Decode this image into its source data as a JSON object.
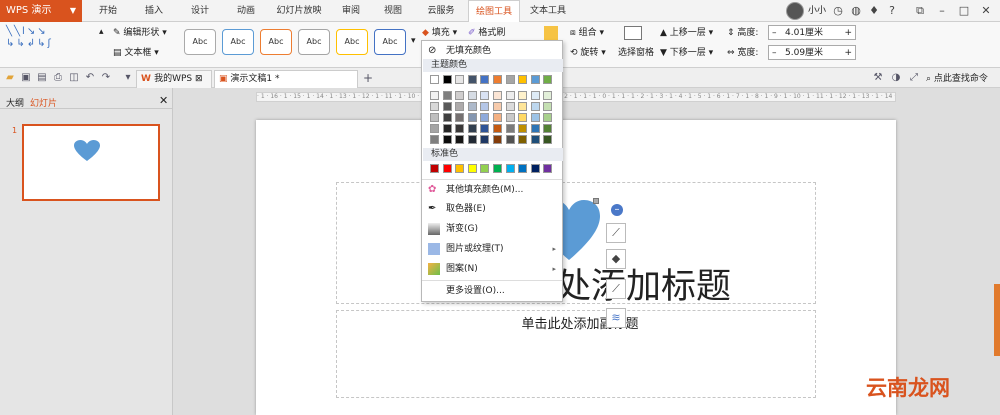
{
  "app": {
    "name": "WPS 演示"
  },
  "menu": {
    "tabs": [
      {
        "label": "开始"
      },
      {
        "label": "插入"
      },
      {
        "label": "设计"
      },
      {
        "label": "动画"
      },
      {
        "label": "幻灯片放映"
      },
      {
        "label": "审阅"
      },
      {
        "label": "视图"
      },
      {
        "label": "云服务"
      },
      {
        "label": "绘图工具"
      },
      {
        "label": "文本工具"
      }
    ]
  },
  "user": {
    "name": "小小"
  },
  "ribbon": {
    "edit_shape": "编辑形状",
    "text_box": "文本框",
    "style_samples": [
      "Abc",
      "Abc",
      "Abc",
      "Abc",
      "Abc",
      "Abc"
    ],
    "fill": "填充",
    "format_painter": "格式刷",
    "group": "组合",
    "rotate": "旋转",
    "selection_pane": "选择窗格",
    "bring_forward": "上移一层",
    "send_backward": "下移一层",
    "height_label": "高度:",
    "height_value": "4.01厘米",
    "width_label": "宽度:",
    "width_value": "5.09厘米"
  },
  "tabs": {
    "docs": [
      {
        "label": "我的WPS"
      },
      {
        "label": "演示文稿1 *"
      }
    ],
    "search": "点此查找命令"
  },
  "panel": {
    "outline": "大纲",
    "slides": "幻灯片",
    "slide_number": "1"
  },
  "ruler": {
    "text": "· 1 · 16 · 1 · 15 · 1 · 14 · 1 · 13 · 1 · 12 · 1 · 11 · 1 · 10 · 1 · 9 · 1 · 8 · 1 · 7 · 1 · 6 · 1 · 5 · 1 · 4 · 1 · 3 · 1 · 2 · 1 · 1 · 1 · 0 · 1 · 1 · 1 · 2 · 1 · 3 · 1 · 4 · 1 · 5 · 1 · 6 · 1 · 7 · 1 · 8 · 1 · 9 · 1 · 10 · 1 · 11 · 1 · 12 · 1 · 13 · 1 · 14 · 1 · 15 · 1 · 16 ·"
  },
  "slide": {
    "title_placeholder": "单击此处添加标题",
    "subtitle_placeholder": "单击此处添加副标题"
  },
  "fill_menu": {
    "no_fill": "无填充颜色",
    "theme_colors_header": "主题颜色",
    "standard_colors_header": "标准色",
    "theme_top": [
      "#ffffff",
      "#000000",
      "#e7e6e6",
      "#44546a",
      "#4472c4",
      "#ed7d31",
      "#a5a5a5",
      "#ffc000",
      "#5b9bd5",
      "#70ad47"
    ],
    "theme_shades": [
      [
        "#f2f2f2",
        "#7f7f7f",
        "#d0cece",
        "#d6dce4",
        "#d9e2f3",
        "#fbe5d5",
        "#ededed",
        "#fff2cc",
        "#deebf6",
        "#e2efd9"
      ],
      [
        "#d8d8d8",
        "#595959",
        "#aeabab",
        "#adb9ca",
        "#b4c6e7",
        "#f7cbac",
        "#dbdbdb",
        "#fee599",
        "#bdd7ee",
        "#c5e0b3"
      ],
      [
        "#bfbfbf",
        "#3f3f3f",
        "#757070",
        "#8496b0",
        "#8eaadb",
        "#f4b183",
        "#c9c9c9",
        "#ffd965",
        "#9dc3e6",
        "#a8d08d"
      ],
      [
        "#a5a5a5",
        "#262626",
        "#3a3838",
        "#323f4f",
        "#2f5496",
        "#c55a11",
        "#7b7b7b",
        "#bf8f00",
        "#2e75b5",
        "#538135"
      ],
      [
        "#7f7f7f",
        "#0c0c0c",
        "#171616",
        "#222a35",
        "#1f3864",
        "#833c0b",
        "#525252",
        "#7f6000",
        "#1e4e79",
        "#375623"
      ]
    ],
    "standard": [
      "#c00000",
      "#ff0000",
      "#ffc000",
      "#ffff00",
      "#92d050",
      "#00b050",
      "#00b0f0",
      "#0070c0",
      "#002060",
      "#7030a0"
    ],
    "items": [
      {
        "label": "其他填充颜色(M)..."
      },
      {
        "label": "取色器(E)"
      },
      {
        "label": "渐变(G)"
      },
      {
        "label": "图片或纹理(T)"
      },
      {
        "label": "图案(N)"
      },
      {
        "label": "更多设置(O)..."
      }
    ]
  },
  "colors": {
    "accent": "#d9531e",
    "heart": "#5b9bd5"
  },
  "watermark": "云南龙网"
}
